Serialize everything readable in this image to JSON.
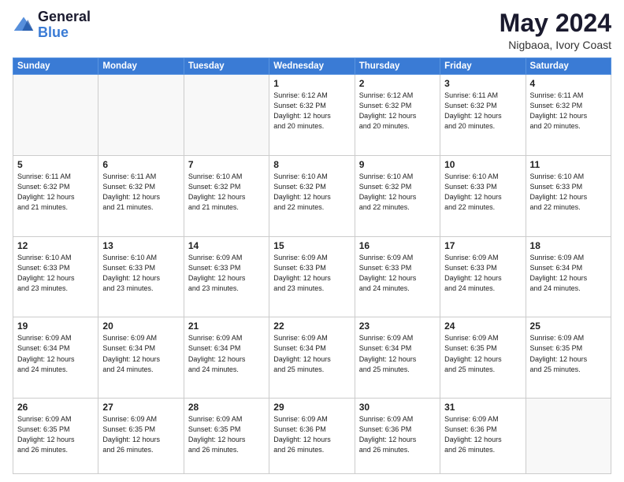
{
  "logo": {
    "line1": "General",
    "line2": "Blue"
  },
  "title": "May 2024",
  "subtitle": "Nigbaoa, Ivory Coast",
  "weekdays": [
    "Sunday",
    "Monday",
    "Tuesday",
    "Wednesday",
    "Thursday",
    "Friday",
    "Saturday"
  ],
  "weeks": [
    [
      {
        "day": "",
        "info": ""
      },
      {
        "day": "",
        "info": ""
      },
      {
        "day": "",
        "info": ""
      },
      {
        "day": "1",
        "info": "Sunrise: 6:12 AM\nSunset: 6:32 PM\nDaylight: 12 hours\nand 20 minutes."
      },
      {
        "day": "2",
        "info": "Sunrise: 6:12 AM\nSunset: 6:32 PM\nDaylight: 12 hours\nand 20 minutes."
      },
      {
        "day": "3",
        "info": "Sunrise: 6:11 AM\nSunset: 6:32 PM\nDaylight: 12 hours\nand 20 minutes."
      },
      {
        "day": "4",
        "info": "Sunrise: 6:11 AM\nSunset: 6:32 PM\nDaylight: 12 hours\nand 20 minutes."
      }
    ],
    [
      {
        "day": "5",
        "info": "Sunrise: 6:11 AM\nSunset: 6:32 PM\nDaylight: 12 hours\nand 21 minutes."
      },
      {
        "day": "6",
        "info": "Sunrise: 6:11 AM\nSunset: 6:32 PM\nDaylight: 12 hours\nand 21 minutes."
      },
      {
        "day": "7",
        "info": "Sunrise: 6:10 AM\nSunset: 6:32 PM\nDaylight: 12 hours\nand 21 minutes."
      },
      {
        "day": "8",
        "info": "Sunrise: 6:10 AM\nSunset: 6:32 PM\nDaylight: 12 hours\nand 22 minutes."
      },
      {
        "day": "9",
        "info": "Sunrise: 6:10 AM\nSunset: 6:32 PM\nDaylight: 12 hours\nand 22 minutes."
      },
      {
        "day": "10",
        "info": "Sunrise: 6:10 AM\nSunset: 6:33 PM\nDaylight: 12 hours\nand 22 minutes."
      },
      {
        "day": "11",
        "info": "Sunrise: 6:10 AM\nSunset: 6:33 PM\nDaylight: 12 hours\nand 22 minutes."
      }
    ],
    [
      {
        "day": "12",
        "info": "Sunrise: 6:10 AM\nSunset: 6:33 PM\nDaylight: 12 hours\nand 23 minutes."
      },
      {
        "day": "13",
        "info": "Sunrise: 6:10 AM\nSunset: 6:33 PM\nDaylight: 12 hours\nand 23 minutes."
      },
      {
        "day": "14",
        "info": "Sunrise: 6:09 AM\nSunset: 6:33 PM\nDaylight: 12 hours\nand 23 minutes."
      },
      {
        "day": "15",
        "info": "Sunrise: 6:09 AM\nSunset: 6:33 PM\nDaylight: 12 hours\nand 23 minutes."
      },
      {
        "day": "16",
        "info": "Sunrise: 6:09 AM\nSunset: 6:33 PM\nDaylight: 12 hours\nand 24 minutes."
      },
      {
        "day": "17",
        "info": "Sunrise: 6:09 AM\nSunset: 6:33 PM\nDaylight: 12 hours\nand 24 minutes."
      },
      {
        "day": "18",
        "info": "Sunrise: 6:09 AM\nSunset: 6:34 PM\nDaylight: 12 hours\nand 24 minutes."
      }
    ],
    [
      {
        "day": "19",
        "info": "Sunrise: 6:09 AM\nSunset: 6:34 PM\nDaylight: 12 hours\nand 24 minutes."
      },
      {
        "day": "20",
        "info": "Sunrise: 6:09 AM\nSunset: 6:34 PM\nDaylight: 12 hours\nand 24 minutes."
      },
      {
        "day": "21",
        "info": "Sunrise: 6:09 AM\nSunset: 6:34 PM\nDaylight: 12 hours\nand 24 minutes."
      },
      {
        "day": "22",
        "info": "Sunrise: 6:09 AM\nSunset: 6:34 PM\nDaylight: 12 hours\nand 25 minutes."
      },
      {
        "day": "23",
        "info": "Sunrise: 6:09 AM\nSunset: 6:34 PM\nDaylight: 12 hours\nand 25 minutes."
      },
      {
        "day": "24",
        "info": "Sunrise: 6:09 AM\nSunset: 6:35 PM\nDaylight: 12 hours\nand 25 minutes."
      },
      {
        "day": "25",
        "info": "Sunrise: 6:09 AM\nSunset: 6:35 PM\nDaylight: 12 hours\nand 25 minutes."
      }
    ],
    [
      {
        "day": "26",
        "info": "Sunrise: 6:09 AM\nSunset: 6:35 PM\nDaylight: 12 hours\nand 26 minutes."
      },
      {
        "day": "27",
        "info": "Sunrise: 6:09 AM\nSunset: 6:35 PM\nDaylight: 12 hours\nand 26 minutes."
      },
      {
        "day": "28",
        "info": "Sunrise: 6:09 AM\nSunset: 6:35 PM\nDaylight: 12 hours\nand 26 minutes."
      },
      {
        "day": "29",
        "info": "Sunrise: 6:09 AM\nSunset: 6:36 PM\nDaylight: 12 hours\nand 26 minutes."
      },
      {
        "day": "30",
        "info": "Sunrise: 6:09 AM\nSunset: 6:36 PM\nDaylight: 12 hours\nand 26 minutes."
      },
      {
        "day": "31",
        "info": "Sunrise: 6:09 AM\nSunset: 6:36 PM\nDaylight: 12 hours\nand 26 minutes."
      },
      {
        "day": "",
        "info": ""
      }
    ]
  ]
}
